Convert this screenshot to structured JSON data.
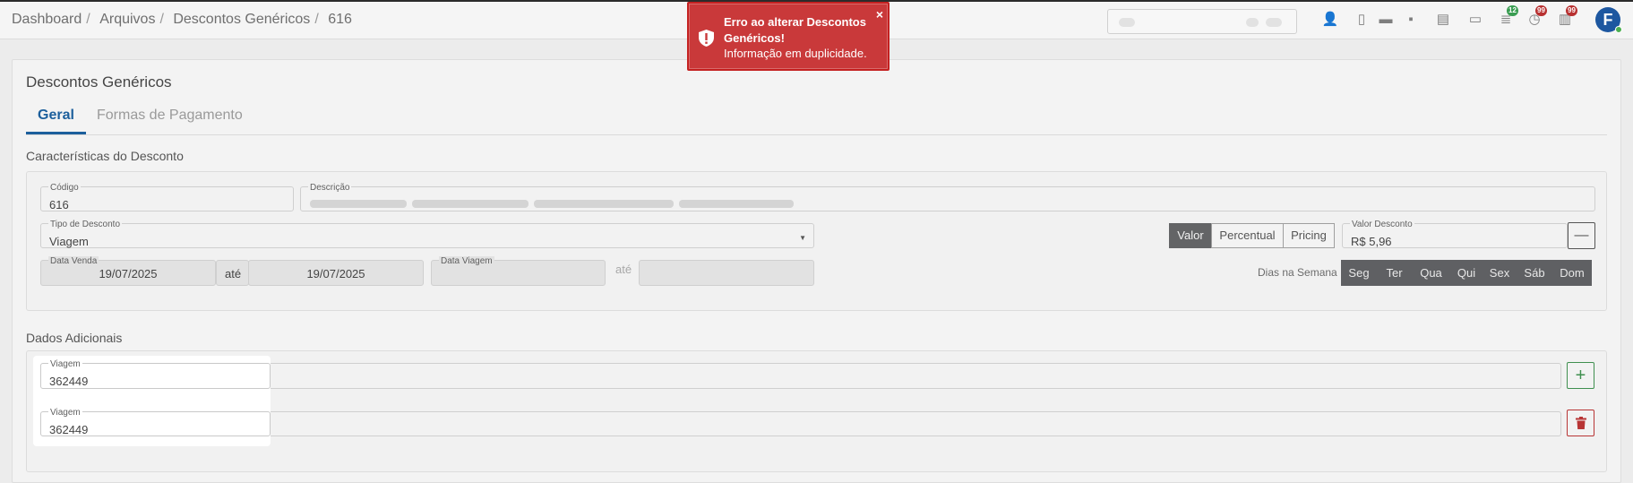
{
  "breadcrumb": [
    "Dashboard",
    "Arquivos",
    "Descontos Genéricos",
    "616"
  ],
  "topbar": {
    "icons": [
      {
        "name": "user-settings-icon",
        "glyph": "👤"
      },
      {
        "name": "mobile-icon",
        "glyph": "▯"
      },
      {
        "name": "card-icon",
        "glyph": "▬"
      },
      {
        "name": "save-icon",
        "glyph": "▪"
      },
      {
        "name": "document-icon",
        "glyph": "▤"
      },
      {
        "name": "monitor-icon",
        "glyph": "▭"
      },
      {
        "name": "stack-icon",
        "glyph": "≣",
        "badge": "12",
        "badge_color": "green"
      },
      {
        "name": "clock-icon",
        "glyph": "◷",
        "badge": "99",
        "badge_color": "red"
      },
      {
        "name": "clipboard-icon",
        "glyph": "▥",
        "badge": "99",
        "badge_color": "red"
      }
    ],
    "avatar_letter": "F"
  },
  "toast": {
    "title": "Erro ao alterar Descontos Genéricos!",
    "message": "Informação em duplicidade.",
    "close": "×",
    "color": "#c9393a"
  },
  "card": {
    "title": "Descontos Genéricos",
    "tabs": [
      "Geral",
      "Formas de Pagamento"
    ]
  },
  "caracteristicas": {
    "title": "Características do Desconto",
    "codigo": {
      "label": "Código",
      "value": "616"
    },
    "descricao": {
      "label": "Descrição"
    },
    "tipo": {
      "label": "Tipo de Desconto",
      "value": "Viagem"
    },
    "tipo_valor": {
      "options": [
        "Valor",
        "Percentual",
        "Pricing"
      ],
      "selected": "Valor"
    },
    "valor_desconto": {
      "label": "Valor Desconto",
      "value": "R$ 5,96",
      "button": "—"
    },
    "data_venda": {
      "label": "Data Venda",
      "from": "19/07/2025",
      "ate": "até",
      "to": "19/07/2025"
    },
    "data_viagem": {
      "label": "Data Viagem",
      "ate": "até"
    },
    "dias": {
      "label": "Dias na Semana",
      "days": [
        "Seg",
        "Ter",
        "Qua",
        "Qui",
        "Sex",
        "Sáb",
        "Dom"
      ]
    }
  },
  "adicionais": {
    "title": "Dados Adicionais",
    "rows": [
      {
        "label": "Viagem",
        "value": "362449",
        "button": "+"
      },
      {
        "label": "Viagem",
        "value": "362449",
        "button": "trash"
      }
    ]
  }
}
